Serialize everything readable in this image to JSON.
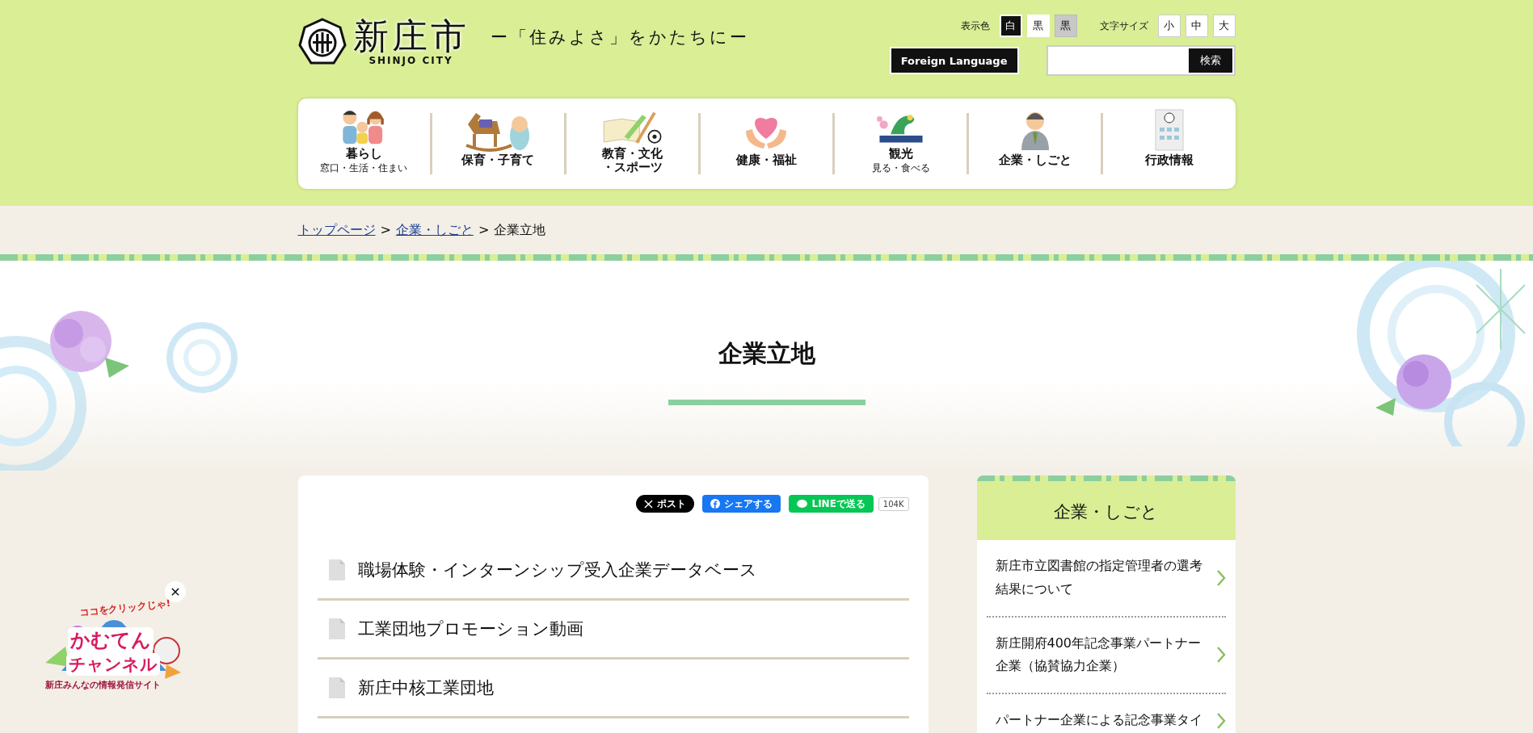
{
  "header": {
    "logo_title": "新庄市",
    "logo_subtitle": "SHINJO CITY",
    "tagline": "ー「住みよさ」をかたちにー",
    "color_label": "表示色",
    "color_options": [
      {
        "label": "白",
        "kind": "white",
        "selected": true
      },
      {
        "label": "黒",
        "kind": "black",
        "selected": false
      },
      {
        "label": "黒",
        "kind": "gray",
        "selected": false
      }
    ],
    "size_label": "文字サイズ",
    "size_options": [
      "小",
      "中",
      "大"
    ],
    "foreign_language": "Foreign Language",
    "search_button": "検索"
  },
  "nav": [
    {
      "label": "暮らし",
      "sub": "窓口・生活・住まい",
      "kind": "family"
    },
    {
      "label": "保育・子育て",
      "kind": "baby"
    },
    {
      "label": "教育・文化",
      "label_2": "・スポーツ",
      "kind": "school"
    },
    {
      "label": "健康・福祉",
      "kind": "heart"
    },
    {
      "label": "観光",
      "sub": "見る・食べる",
      "kind": "dragon"
    },
    {
      "label": "企業・しごと",
      "kind": "worker"
    },
    {
      "label": "行政情報",
      "kind": "building"
    }
  ],
  "breadcrumb": {
    "separator": ">",
    "items": [
      {
        "label": "トップページ",
        "link": true
      },
      {
        "label": "企業・しごと",
        "link": true
      },
      {
        "label": "企業立地",
        "link": false
      }
    ]
  },
  "page_title": "企業立地",
  "share": {
    "post": "ポスト",
    "facebook": "シェアする",
    "line": "LINEで送る",
    "count": "104K"
  },
  "links": [
    "職場体験・インターンシップ受入企業データベース",
    "工業団地プロモーション動画",
    "新庄中核工業団地"
  ],
  "sidebar": {
    "title": "企業・しごと",
    "items": [
      "新庄市立図書館の指定管理者の選考結果について",
      "新庄開府400年記念事業パートナー企業（協賛協力企業）",
      "パートナー企業による記念事業タイ"
    ]
  },
  "banner": {
    "top": "ココをクリックじゃ!",
    "title_1": "かむてん",
    "title_2": "チャンネル",
    "caption": "新庄みんなの情報発信サイト",
    "close": "✕"
  }
}
